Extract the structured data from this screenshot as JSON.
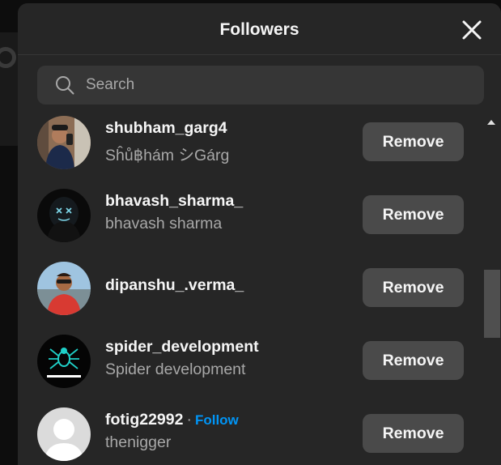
{
  "dialog": {
    "title": "Followers",
    "close_icon": "close-icon"
  },
  "search": {
    "placeholder": "Search",
    "value": "",
    "icon": "search-icon"
  },
  "followers": [
    {
      "username": "shubham_garg4",
      "full_name": "Sĥů฿hám シGárg",
      "action": "Remove"
    },
    {
      "username": "bhavash_sharma_",
      "full_name": "bhavash sharma",
      "action": "Remove"
    },
    {
      "username": "dipanshu_.verma_",
      "full_name": "",
      "action": "Remove"
    },
    {
      "username": "spider_development",
      "full_name": "Spider development",
      "action": "Remove"
    },
    {
      "username": "fotig22992",
      "separator": "·",
      "follow_label": "Follow",
      "full_name": "thenigger",
      "action": "Remove"
    }
  ],
  "colors": {
    "modal_bg": "#262626",
    "search_bg": "#363636",
    "button_bg": "#4a4a4a",
    "follow_link": "#0095f6",
    "primary_text": "#f5f5f5",
    "secondary_text": "#a8a8a8"
  }
}
